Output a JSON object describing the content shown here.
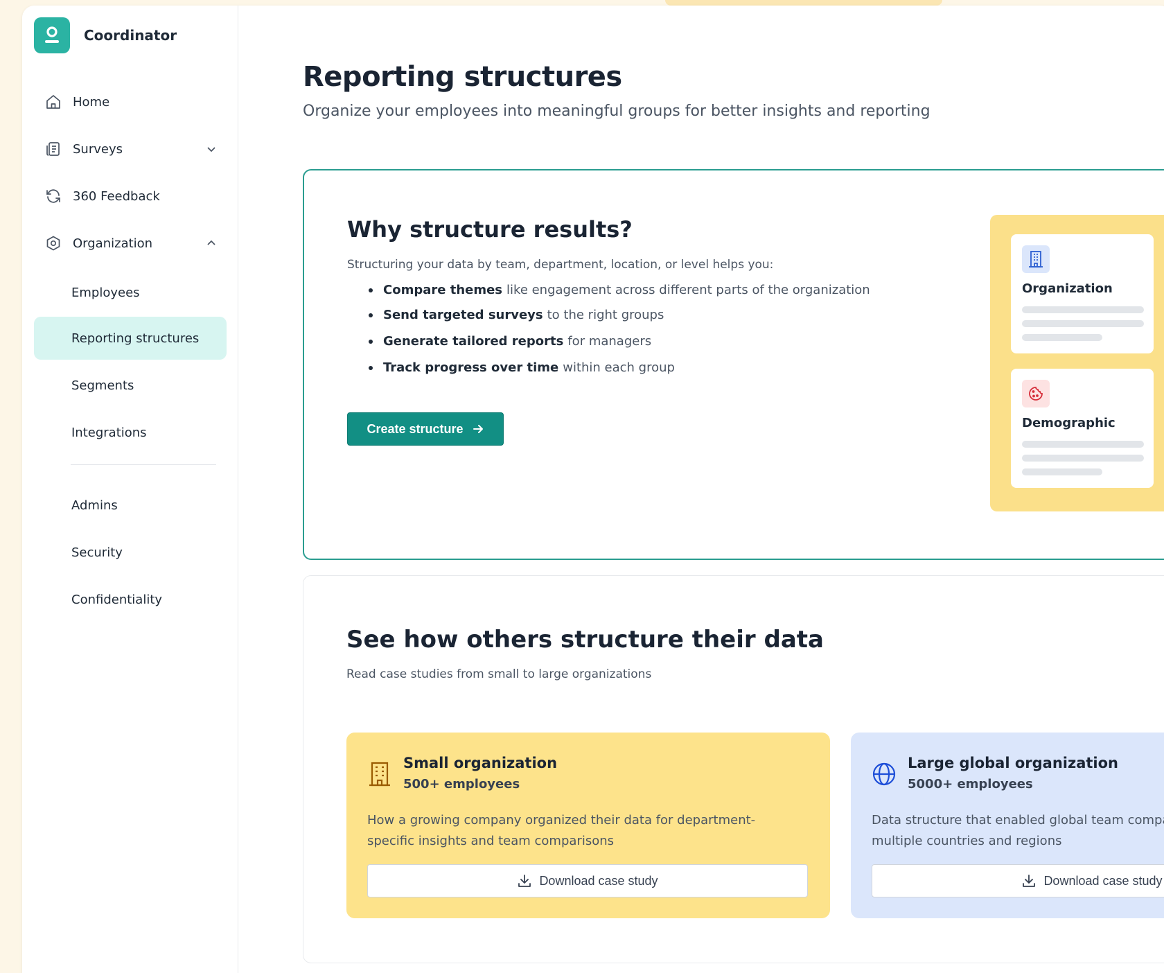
{
  "app": {
    "name": "Coordinator"
  },
  "sidebar": {
    "nav": [
      {
        "label": "Home",
        "icon": "home-icon"
      },
      {
        "label": "Surveys",
        "icon": "survey-icon",
        "chevron": "chevron-down-icon"
      },
      {
        "label": "360 Feedback",
        "icon": "refresh-icon"
      },
      {
        "label": "Organization",
        "icon": "org-gear-icon",
        "chevron": "chevron-up-icon"
      }
    ],
    "org_items": [
      "Employees",
      "Reporting structures",
      "Segments",
      "Integrations"
    ],
    "admin_items": [
      "Admins",
      "Security",
      "Confidentiality"
    ],
    "active": "Reporting structures"
  },
  "page": {
    "title": "Reporting structures",
    "subtitle": "Organize your employees into meaningful groups for better insights and reporting"
  },
  "why": {
    "title": "Why structure results?",
    "intro": "Structuring your data by team, department, location, or level helps you:",
    "points": [
      {
        "strong": "Compare themes",
        "rest": "like engagement across different parts of the organization"
      },
      {
        "strong": "Send targeted surveys",
        "rest": "to the right groups"
      },
      {
        "strong": "Generate tailored reports",
        "rest": "for managers"
      },
      {
        "strong": "Track progress over time",
        "rest": "within each group"
      }
    ],
    "cta": "Create structure",
    "illustration": {
      "cards": [
        {
          "label": "Organization",
          "icon": "building-icon"
        },
        {
          "label": "Demographic",
          "icon": "cookie-icon"
        }
      ]
    }
  },
  "others": {
    "title": "See how others structure their data",
    "subtitle": "Read case studies from small to large organizations",
    "cases": [
      {
        "title": "Small organization",
        "size": "500+ employees",
        "desc": "How a growing company organized their data for department-specific insights and team comparisons",
        "button": "Download case study",
        "icon": "building-icon"
      },
      {
        "title": "Large global organization",
        "size": "5000+ employees",
        "desc": "Data structure that enabled global team comparisons across multiple countries and regions",
        "button": "Download case study",
        "icon": "globe-icon"
      }
    ]
  },
  "colors": {
    "brand": "#2bb3a3",
    "primary_button": "#128f84",
    "active_nav": "#d7f5f1",
    "highlight_yellow": "#fbe08a",
    "case_blue": "#dbe6fb"
  }
}
